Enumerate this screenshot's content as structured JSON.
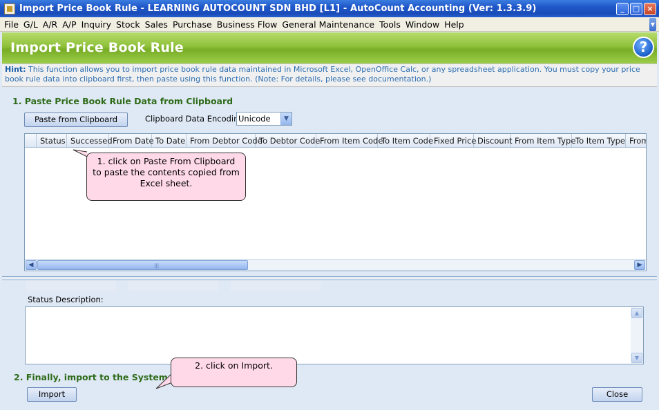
{
  "window": {
    "title": "Import Price Book Rule - LEARNING AUTOCOUNT SDN BHD [L1] - AutoCount Accounting (Ver: 1.3.3.9)",
    "minimize": "_",
    "maximize": "□",
    "close": "×"
  },
  "menu": [
    "File",
    "G/L",
    "A/R",
    "A/P",
    "Inquiry",
    "Stock",
    "Sales",
    "Purchase",
    "Business Flow",
    "General Maintenance",
    "Tools",
    "Window",
    "Help"
  ],
  "header": {
    "title": "Import Price Book Rule",
    "help": "?"
  },
  "hint": {
    "label": "Hint:",
    "text": "This function allows you to import price book rule data maintained in Microsoft Excel, OpenOffice Calc, or any spreadsheet application. You must copy your price book rule data into clipboard first, then paste using this function. (Note: For details, please see documentation.)"
  },
  "step1": {
    "title": "1. Paste Price Book Rule Data from Clipboard",
    "paste_button": "Paste from Clipboard",
    "encoding_label": "Clipboard Data Encoding",
    "encoding_value": "Unicode"
  },
  "grid": {
    "columns": [
      "Status",
      "Successed",
      "From Date",
      "To Date",
      "From Debtor Code",
      "To Debtor Code",
      "From Item Code",
      "To Item Code",
      "Fixed Price",
      "Discount",
      "From Item Type",
      "To Item Type",
      "From"
    ]
  },
  "status": {
    "label": "Status Description:",
    "value": ""
  },
  "step2": {
    "title": "2. Finally, import to the System.",
    "import_button": "Import",
    "close_button": "Close"
  },
  "callouts": {
    "first": "1. click on Paste From Clipboard to paste the contents copied from Excel sheet.",
    "second": "2. click on Import."
  },
  "colors": {
    "header_green": "#8fc03a",
    "section_green": "#2e6b19",
    "callout_pink": "#ffd9e8",
    "titlebar_blue": "#1f57c9"
  }
}
